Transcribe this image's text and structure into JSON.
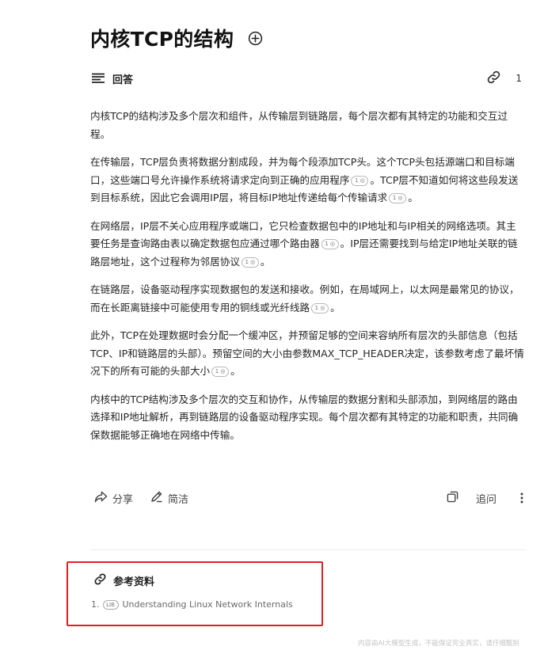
{
  "page": {
    "title": "内核TCP的结构",
    "answer_label": "回答",
    "reference_count": "1"
  },
  "answer": {
    "citation_label": "1 ◎",
    "paragraphs": [
      {
        "text": "内核TCP的结构涉及多个层次和组件，从传输层到链路层，每个层次都有其特定的功能和交互过程。"
      },
      {
        "text": "在传输层，TCP层负责将数据分割成段，并为每个段添加TCP头。这个TCP头包括源端口和目标端口，这些端口号允许操作系统将请求定向到正确的应用程序",
        "text2": "。TCP层不知道如何将这些段发送到目标系统，因此它会调用IP层，将目标IP地址传递给每个传输请求",
        "text3": "。"
      },
      {
        "text": "在网络层，IP层不关心应用程序或端口，它只检查数据包中的IP地址和与IP相关的网络选项。其主要任务是查询路由表以确定数据包应通过哪个路由器",
        "text2": "。IP层还需要找到与给定IP地址关联的链路层地址，这个过程称为邻居协议",
        "text3": "。"
      },
      {
        "text": "在链路层，设备驱动程序实现数据包的发送和接收。例如，在局域网上，以太网是最常见的协议，而在长距离链接中可能使用专用的铜线或光纤线路",
        "text2": "。"
      },
      {
        "text": "此外，TCP在处理数据时会分配一个缓冲区，并预留足够的空间来容纳所有层次的头部信息（包括TCP、IP和链路层的头部）。预留空间的大小由参数MAX_TCP_HEADER决定，该参数考虑了最坏情况下的所有可能的头部大小",
        "text2": "。"
      },
      {
        "text": "内核中的TCP结构涉及多个层次的交互和协作，从传输层的数据分割和头部添加，到网络层的路由选择和IP地址解析，再到链路层的设备驱动程序实现。每个层次都有其特定的功能和职责，共同确保数据能够正确地在网络中传输。"
      }
    ]
  },
  "actions": {
    "share": "分享",
    "simplify": "简洁",
    "ask": "追问"
  },
  "references": {
    "title": "参考资料",
    "items": [
      {
        "index": "1.",
        "badge": "LIB",
        "title": "Understanding Linux Network Internals"
      }
    ]
  },
  "footer": {
    "note": "内容由AI大模型生成，不能保证完全真实，请仔细甄别"
  },
  "colors": {
    "highlight_border": "#e02020",
    "text": "#262626"
  }
}
